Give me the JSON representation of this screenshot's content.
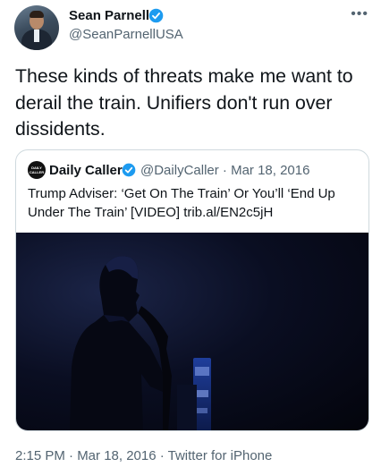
{
  "author": {
    "name": "Sean Parnell",
    "handle": "@SeanParnellUSA"
  },
  "tweet": {
    "text": "These kinds of threats make me want to derail the train. Unifiers don't run over dissidents."
  },
  "quoted_tweet": {
    "author_name": "Daily Caller",
    "avatar_text": "DAILY CALLER",
    "meta": "@DailyCaller · Mar 18, 2016",
    "text": "Trump Adviser: ‘Get On The Train’ Or You’ll ‘End Up Under The Train’ [VIDEO] trib.al/EN2c5jH"
  },
  "footer": {
    "timestamp": "2:15 PM · Mar 18, 2016 · Twitter for iPhone"
  },
  "icons": {
    "verified": "verified-badge-icon",
    "more": "more-options-icon"
  },
  "colors": {
    "verified_blue": "#1d9bf0",
    "secondary_text": "#536471",
    "primary_text": "#0f1419",
    "border": "#cfd9de"
  }
}
